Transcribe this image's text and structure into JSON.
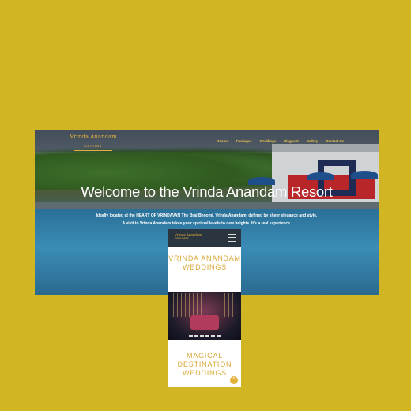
{
  "site": {
    "logo_main": "Vrinda Anandam",
    "logo_sub": "RESORT"
  },
  "nav": {
    "items": [
      "Rooms",
      "Packages",
      "Weddings",
      "Blogpost",
      "Gallery",
      "Contact Us"
    ]
  },
  "hero": {
    "title": "Welcome to the Vrinda Anandam Resort",
    "line1_a": "Ideally located at the ",
    "line1_b": "HEART OF VRINDAVAN",
    "line1_c": " The Braj Bhoomi. Vrinda Anandam, defined by sheer elegance and style.",
    "line2": "A visit to Vrinda Anandam takes your spiritual levels to new heights. It's a real experience."
  },
  "mobile": {
    "logo_main": "Vrinda Anandam",
    "logo_sub": "RESORT",
    "heading1": "VRINDA ANANDAM WEDDINGS",
    "heading2": "MAGICAL DESTINATION WEDDINGS",
    "top_icon": "chevron-up-icon"
  },
  "colors": {
    "background": "#d2b522",
    "accent": "#e3b23c"
  }
}
